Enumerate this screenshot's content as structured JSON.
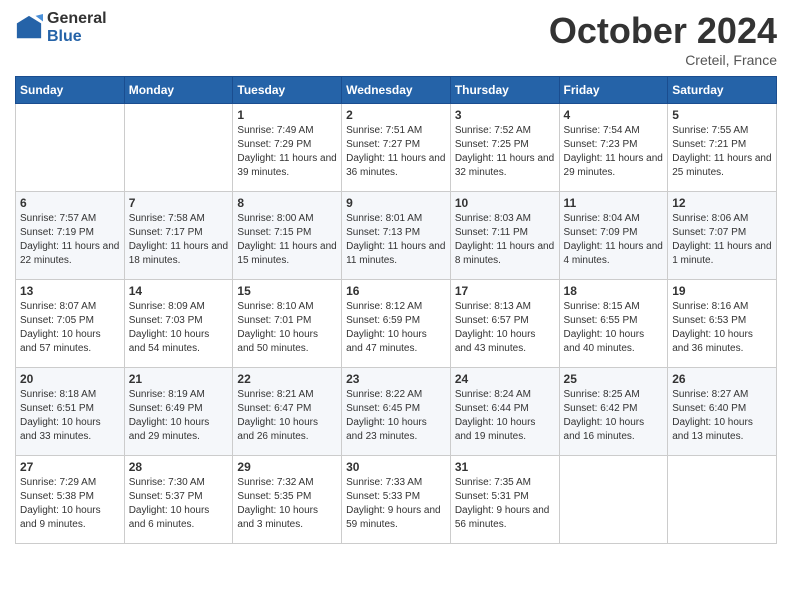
{
  "header": {
    "logo_general": "General",
    "logo_blue": "Blue",
    "month_title": "October 2024",
    "location": "Creteil, France"
  },
  "days_of_week": [
    "Sunday",
    "Monday",
    "Tuesday",
    "Wednesday",
    "Thursday",
    "Friday",
    "Saturday"
  ],
  "weeks": [
    [
      {
        "day": "",
        "info": ""
      },
      {
        "day": "",
        "info": ""
      },
      {
        "day": "1",
        "info": "Sunrise: 7:49 AM\nSunset: 7:29 PM\nDaylight: 11 hours and 39 minutes."
      },
      {
        "day": "2",
        "info": "Sunrise: 7:51 AM\nSunset: 7:27 PM\nDaylight: 11 hours and 36 minutes."
      },
      {
        "day": "3",
        "info": "Sunrise: 7:52 AM\nSunset: 7:25 PM\nDaylight: 11 hours and 32 minutes."
      },
      {
        "day": "4",
        "info": "Sunrise: 7:54 AM\nSunset: 7:23 PM\nDaylight: 11 hours and 29 minutes."
      },
      {
        "day": "5",
        "info": "Sunrise: 7:55 AM\nSunset: 7:21 PM\nDaylight: 11 hours and 25 minutes."
      }
    ],
    [
      {
        "day": "6",
        "info": "Sunrise: 7:57 AM\nSunset: 7:19 PM\nDaylight: 11 hours and 22 minutes."
      },
      {
        "day": "7",
        "info": "Sunrise: 7:58 AM\nSunset: 7:17 PM\nDaylight: 11 hours and 18 minutes."
      },
      {
        "day": "8",
        "info": "Sunrise: 8:00 AM\nSunset: 7:15 PM\nDaylight: 11 hours and 15 minutes."
      },
      {
        "day": "9",
        "info": "Sunrise: 8:01 AM\nSunset: 7:13 PM\nDaylight: 11 hours and 11 minutes."
      },
      {
        "day": "10",
        "info": "Sunrise: 8:03 AM\nSunset: 7:11 PM\nDaylight: 11 hours and 8 minutes."
      },
      {
        "day": "11",
        "info": "Sunrise: 8:04 AM\nSunset: 7:09 PM\nDaylight: 11 hours and 4 minutes."
      },
      {
        "day": "12",
        "info": "Sunrise: 8:06 AM\nSunset: 7:07 PM\nDaylight: 11 hours and 1 minute."
      }
    ],
    [
      {
        "day": "13",
        "info": "Sunrise: 8:07 AM\nSunset: 7:05 PM\nDaylight: 10 hours and 57 minutes."
      },
      {
        "day": "14",
        "info": "Sunrise: 8:09 AM\nSunset: 7:03 PM\nDaylight: 10 hours and 54 minutes."
      },
      {
        "day": "15",
        "info": "Sunrise: 8:10 AM\nSunset: 7:01 PM\nDaylight: 10 hours and 50 minutes."
      },
      {
        "day": "16",
        "info": "Sunrise: 8:12 AM\nSunset: 6:59 PM\nDaylight: 10 hours and 47 minutes."
      },
      {
        "day": "17",
        "info": "Sunrise: 8:13 AM\nSunset: 6:57 PM\nDaylight: 10 hours and 43 minutes."
      },
      {
        "day": "18",
        "info": "Sunrise: 8:15 AM\nSunset: 6:55 PM\nDaylight: 10 hours and 40 minutes."
      },
      {
        "day": "19",
        "info": "Sunrise: 8:16 AM\nSunset: 6:53 PM\nDaylight: 10 hours and 36 minutes."
      }
    ],
    [
      {
        "day": "20",
        "info": "Sunrise: 8:18 AM\nSunset: 6:51 PM\nDaylight: 10 hours and 33 minutes."
      },
      {
        "day": "21",
        "info": "Sunrise: 8:19 AM\nSunset: 6:49 PM\nDaylight: 10 hours and 29 minutes."
      },
      {
        "day": "22",
        "info": "Sunrise: 8:21 AM\nSunset: 6:47 PM\nDaylight: 10 hours and 26 minutes."
      },
      {
        "day": "23",
        "info": "Sunrise: 8:22 AM\nSunset: 6:45 PM\nDaylight: 10 hours and 23 minutes."
      },
      {
        "day": "24",
        "info": "Sunrise: 8:24 AM\nSunset: 6:44 PM\nDaylight: 10 hours and 19 minutes."
      },
      {
        "day": "25",
        "info": "Sunrise: 8:25 AM\nSunset: 6:42 PM\nDaylight: 10 hours and 16 minutes."
      },
      {
        "day": "26",
        "info": "Sunrise: 8:27 AM\nSunset: 6:40 PM\nDaylight: 10 hours and 13 minutes."
      }
    ],
    [
      {
        "day": "27",
        "info": "Sunrise: 7:29 AM\nSunset: 5:38 PM\nDaylight: 10 hours and 9 minutes."
      },
      {
        "day": "28",
        "info": "Sunrise: 7:30 AM\nSunset: 5:37 PM\nDaylight: 10 hours and 6 minutes."
      },
      {
        "day": "29",
        "info": "Sunrise: 7:32 AM\nSunset: 5:35 PM\nDaylight: 10 hours and 3 minutes."
      },
      {
        "day": "30",
        "info": "Sunrise: 7:33 AM\nSunset: 5:33 PM\nDaylight: 9 hours and 59 minutes."
      },
      {
        "day": "31",
        "info": "Sunrise: 7:35 AM\nSunset: 5:31 PM\nDaylight: 9 hours and 56 minutes."
      },
      {
        "day": "",
        "info": ""
      },
      {
        "day": "",
        "info": ""
      }
    ]
  ]
}
